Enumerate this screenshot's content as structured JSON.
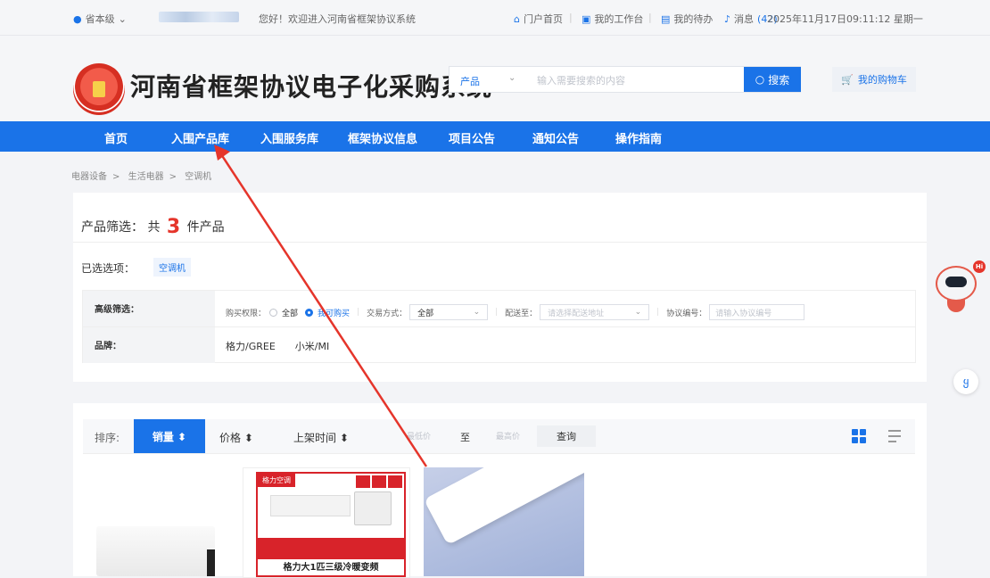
{
  "topbar": {
    "region": "省本级",
    "welcome": "您好！欢迎进入河南省框架协议系统",
    "links": [
      "门户首页",
      "我的工作台",
      "我的待办"
    ],
    "messages_label": "消息",
    "messages_count": "(42)",
    "datetime": "2025年11月17日09:11:12 星期一"
  },
  "header": {
    "site_title": "河南省框架协议电子化采购系统",
    "search_category": "产品",
    "search_placeholder": "输入需要搜索的内容",
    "search_button": "搜索",
    "cart_button": "我的购物车"
  },
  "nav": {
    "items": [
      "首页",
      "入围产品库",
      "入围服务库",
      "框架协议信息",
      "项目公告",
      "通知公告",
      "操作指南"
    ]
  },
  "breadcrumb": [
    "电器设备",
    "生活电器",
    "空调机"
  ],
  "filter": {
    "count_prefix": "产品筛选：",
    "count_mid": "共",
    "count": "3",
    "count_suffix": "件产品",
    "selected_label": "已选选项：",
    "selected_tag": "空调机",
    "advanced_label": "高级筛选：",
    "purchase_right_label": "购买权限：",
    "purchase_all": "全部",
    "purchase_can": "我可购买",
    "trade_label": "交易方式：",
    "trade_value": "全部",
    "delivery_label": "配送至：",
    "delivery_placeholder": "请选择配送地址",
    "agreement_label": "协议编号：",
    "agreement_placeholder": "请输入协议编号",
    "brand_label": "品牌：",
    "brands": [
      "格力/GREE",
      "小米/MI"
    ]
  },
  "sort": {
    "label": "排序:",
    "sales": "销量 ⬍",
    "price": "价格 ⬍",
    "listing_time": "上架时间 ⬍",
    "min_price": "最低价",
    "to": "至",
    "max_price": "最高价",
    "query": "查询"
  },
  "products": {
    "card2_ribbon": "格力空调",
    "card2_title": "格力大1匹三级冷暖变频"
  },
  "robot_badge": "Hi",
  "side_icon": "ყ",
  "icons": {
    "location": "location-pin-icon",
    "search": "search-icon",
    "cart": "cart-icon",
    "grid": "grid-view-icon",
    "list": "list-view-icon"
  },
  "colors": {
    "primary": "#1a73e8",
    "accent_red": "#e5352b"
  }
}
